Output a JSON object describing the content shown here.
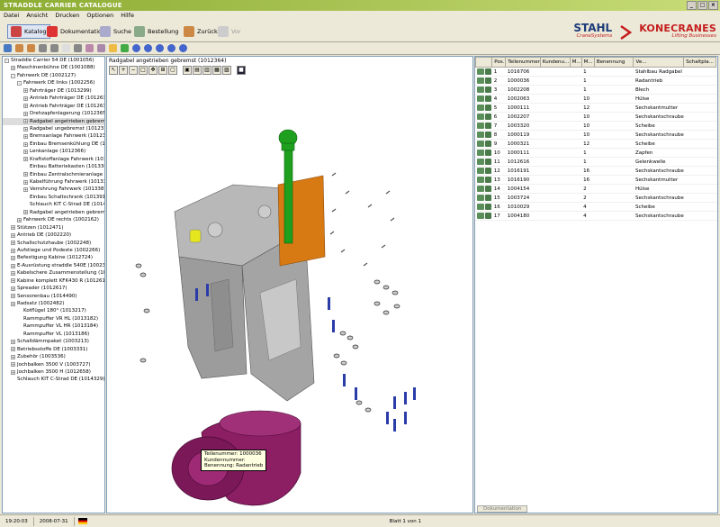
{
  "app": {
    "title": "STRADDLE CARRIER CATALOGUE"
  },
  "menu": [
    "Datei",
    "Ansicht",
    "Drucken",
    "Optionen",
    "Hilfe"
  ],
  "toolbar": {
    "katalog": "Katalog",
    "dokumentation": "Dokumentation",
    "suche": "Suche",
    "bestellung": "Bestellung",
    "zurueck": "Zurück",
    "vor": "Vor"
  },
  "brand": {
    "stahl": "STAHL",
    "stahl_sub": "CraneSystems",
    "kone": "KONECRANES",
    "kone_sub": "Lifting Businesses"
  },
  "tree": [
    {
      "d": 0,
      "t": "-",
      "label": "Straddle Carrier 54 DE (1001056)"
    },
    {
      "d": 1,
      "t": "+",
      "label": "Maschinenbühne DE (1001088)"
    },
    {
      "d": 1,
      "t": "-",
      "label": "Fahrwerk DE (1002127)"
    },
    {
      "d": 2,
      "t": "-",
      "label": "Fahrwerk DE links (1002256)"
    },
    {
      "d": 3,
      "t": "+",
      "label": "Fahrträger DE (1013299)"
    },
    {
      "d": 3,
      "t": "+",
      "label": "Antrieb Fahrträger DE (1012631)"
    },
    {
      "d": 3,
      "t": "+",
      "label": "Antrieb Fahrträger DE (1012632)"
    },
    {
      "d": 3,
      "t": "+",
      "label": "Drehzapfenlagerung (1012365)"
    },
    {
      "d": 3,
      "t": "+",
      "label": "Radgabel angetrieben gebremst (1012364)",
      "sel": true
    },
    {
      "d": 3,
      "t": "+",
      "label": "Radgabel ungebremst (1012377)"
    },
    {
      "d": 3,
      "t": "+",
      "label": "Bremsanlage Fahrwerk (1012367)"
    },
    {
      "d": 3,
      "t": "+",
      "label": "Einbau Bremsenkühlung DE (1012..."
    },
    {
      "d": 3,
      "t": "+",
      "label": "Lenkanlage (1012366)"
    },
    {
      "d": 3,
      "t": "+",
      "label": "Kraftstoffanlage Fahrwerk (1012..."
    },
    {
      "d": 3,
      "t": "",
      "label": "Einbau Batteriekasten (1013368)"
    },
    {
      "d": 3,
      "t": "+",
      "label": "Einbau Zentralschmieranlage (101..."
    },
    {
      "d": 3,
      "t": "+",
      "label": "Kabelführung Fahrwerk (1013386)"
    },
    {
      "d": 3,
      "t": "+",
      "label": "Verrohrung Fahrwerk (1013387)"
    },
    {
      "d": 3,
      "t": "",
      "label": "Einbau Schaltschrank (1013911)"
    },
    {
      "d": 3,
      "t": "",
      "label": "Schlauch KIT C-Strad DE (101484..."
    },
    {
      "d": 3,
      "t": "+",
      "label": "Radgabel angetrieben gebremst (..."
    },
    {
      "d": 2,
      "t": "+",
      "label": "Fahrwerk DE rechts (1002162)"
    },
    {
      "d": 1,
      "t": "+",
      "label": "Stützen (1012471)"
    },
    {
      "d": 1,
      "t": "+",
      "label": "Antrieb DE (1002220)"
    },
    {
      "d": 1,
      "t": "+",
      "label": "Schallschutzhaube (1002248)"
    },
    {
      "d": 1,
      "t": "+",
      "label": "Aufstiege und Podeste (1002266)"
    },
    {
      "d": 1,
      "t": "+",
      "label": "Befestigung Kabine (1012724)"
    },
    {
      "d": 1,
      "t": "+",
      "label": "E-Ausrüstung straddle 540E (1002396)"
    },
    {
      "d": 1,
      "t": "+",
      "label": "Kabelschere Zusammenstellung (101309..."
    },
    {
      "d": 1,
      "t": "+",
      "label": "Kabine komplett KFK430 R (1012618)"
    },
    {
      "d": 1,
      "t": "+",
      "label": "Spreader (1012617)"
    },
    {
      "d": 1,
      "t": "+",
      "label": "Sensorenbau (1014490)"
    },
    {
      "d": 1,
      "t": "+",
      "label": "Radsatz (1002482)"
    },
    {
      "d": 2,
      "t": "",
      "label": "Kotflügel 180° (1013217)"
    },
    {
      "d": 2,
      "t": "",
      "label": "Rammpuffer VR HL (1013182)"
    },
    {
      "d": 2,
      "t": "",
      "label": "Rammpuffer VL HR (1013184)"
    },
    {
      "d": 2,
      "t": "",
      "label": "Rammpuffer VL (1013186)"
    },
    {
      "d": 1,
      "t": "+",
      "label": "Schalldämmpaket (1003213)"
    },
    {
      "d": 1,
      "t": "+",
      "label": "Betriebsstoffe DE (1003331)"
    },
    {
      "d": 1,
      "t": "+",
      "label": "Zubehör (1003536)"
    },
    {
      "d": 1,
      "t": "+",
      "label": "Jochbalken 3500 V (1003727)"
    },
    {
      "d": 1,
      "t": "+",
      "label": "Jochbalken 3500 H (1012658)"
    },
    {
      "d": 1,
      "t": "",
      "label": "Schlauch KIT C-Strad DE (1014329)"
    }
  ],
  "drawing": {
    "title": "Radgabel angetrieben gebremst (1012364)",
    "tooltip": {
      "line1": "Teilenummer: 1000036",
      "line2": "Kundennummer:",
      "line3": "Benennung: Radantrieb"
    }
  },
  "parts_table": {
    "headers": [
      "",
      "Pos.",
      "Teilenummer",
      "Kundenu...",
      "M...",
      "M...",
      "Benennung",
      "Ve...",
      "Schaltpla..."
    ],
    "rows": [
      {
        "pos": "1",
        "nr": "1016706",
        "m1": "1",
        "bez": "Stahlbau Radgabel"
      },
      {
        "pos": "2",
        "nr": "1000036",
        "m1": "1",
        "bez": "Radantrieb"
      },
      {
        "pos": "3",
        "nr": "1002208",
        "m1": "1",
        "bez": "Blech"
      },
      {
        "pos": "4",
        "nr": "1002063",
        "m1": "10",
        "bez": "Hülse"
      },
      {
        "pos": "5",
        "nr": "1000111",
        "m1": "12",
        "bez": "Sechskantmutter"
      },
      {
        "pos": "6",
        "nr": "1002207",
        "m1": "10",
        "bez": "Sechskantschraube"
      },
      {
        "pos": "7",
        "nr": "1003320",
        "m1": "10",
        "bez": "Scheibe"
      },
      {
        "pos": "8",
        "nr": "1000119",
        "m1": "10",
        "bez": "Sechskantschraube"
      },
      {
        "pos": "9",
        "nr": "1000321",
        "m1": "12",
        "bez": "Scheibe"
      },
      {
        "pos": "10",
        "nr": "1000111",
        "m1": "1",
        "bez": "Zapfen"
      },
      {
        "pos": "11",
        "nr": "1012616",
        "m1": "1",
        "bez": "Gelenkwelle"
      },
      {
        "pos": "12",
        "nr": "1016191",
        "m1": "16",
        "bez": "Sechskantschraube"
      },
      {
        "pos": "13",
        "nr": "1016190",
        "m1": "16",
        "bez": "Sechskantmutter"
      },
      {
        "pos": "14",
        "nr": "1004154",
        "m1": "2",
        "bez": "Hülse"
      },
      {
        "pos": "15",
        "nr": "1003724",
        "m1": "2",
        "bez": "Sechskantschraube"
      },
      {
        "pos": "16",
        "nr": "1010029",
        "m1": "4",
        "bez": "Scheibe"
      },
      {
        "pos": "17",
        "nr": "1004180",
        "m1": "4",
        "bez": "Sechskantschraube"
      }
    ],
    "tab_label": "Dokumentation"
  },
  "status": {
    "time": "19:20:03",
    "date": "2008-07-31",
    "page": "Blatt 1 von 1"
  },
  "colors": {
    "titlebar": "#8cac32",
    "part_gray": "#a8a8a8",
    "part_purple": "#8c1e64",
    "part_green": "#1ea01e",
    "part_orange": "#d87a14",
    "part_yellow": "#e6e61e",
    "bolt_blue": "#2a3ca8"
  }
}
